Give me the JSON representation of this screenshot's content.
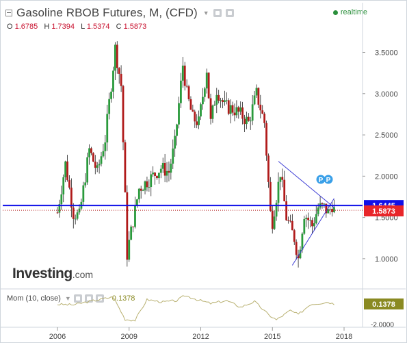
{
  "header": {
    "title": "Gasoline RBOB Futures, M, (CFD)",
    "realtime_label": "realtime"
  },
  "ohlc": {
    "o_label": "O",
    "o_value": "1.6785",
    "h_label": "H",
    "h_value": "1.7394",
    "l_label": "L",
    "l_value": "1.5374",
    "c_label": "C",
    "c_value": "1.5873"
  },
  "indicator": {
    "label": "Mom (10, close)",
    "value": "0.1378",
    "axis_label": "-2.0000"
  },
  "logo": {
    "brand": "Investing",
    "suffix": ".com"
  },
  "price_labels": {
    "resistance": "1.6445",
    "last": "1.5873"
  },
  "markers": [
    "P",
    "P"
  ],
  "colors": {
    "up": "#2a9a3c",
    "down": "#b01a1a",
    "hline": "#1010e8",
    "last_price": "#e8262a",
    "momentum": "#b8b070",
    "trendline": "#3f3fd6"
  },
  "chart_data": {
    "type": "candlestick",
    "title": "Gasoline RBOB Futures, M, (CFD)",
    "x_ticks": [
      "2006",
      "2009",
      "2012",
      "2015",
      "2018"
    ],
    "y_ticks": [
      "1.0000",
      "1.5000",
      "2.0000",
      "2.5000",
      "3.0000",
      "3.5000"
    ],
    "ylim": [
      0.75,
      3.72
    ],
    "interval": "monthly",
    "horizontal_lines": [
      {
        "value": 1.6445,
        "style": "solid"
      },
      {
        "value": 1.5873,
        "style": "dotted"
      }
    ],
    "trendlines": [
      {
        "from": [
          "2015-04",
          2.18
        ],
        "to": [
          "2017-08",
          1.62
        ]
      },
      {
        "from": [
          "2015-11",
          0.92
        ],
        "to": [
          "2017-08",
          1.73
        ]
      }
    ],
    "price_anchors": [
      [
        "2006-01",
        1.56
      ],
      [
        "2006-05",
        2.15
      ],
      [
        "2006-09",
        1.55
      ],
      [
        "2006-12",
        1.52
      ],
      [
        "2007-05",
        2.32
      ],
      [
        "2007-09",
        2.05
      ],
      [
        "2008-01",
        2.45
      ],
      [
        "2008-06",
        3.55
      ],
      [
        "2008-09",
        3.1
      ],
      [
        "2008-12",
        1.05
      ],
      [
        "2009-01",
        1.2
      ],
      [
        "2009-06",
        1.85
      ],
      [
        "2009-12",
        1.98
      ],
      [
        "2010-05",
        2.1
      ],
      [
        "2010-09",
        2.05
      ],
      [
        "2010-12",
        2.4
      ],
      [
        "2011-04",
        3.35
      ],
      [
        "2011-06",
        3.0
      ],
      [
        "2011-09",
        2.7
      ],
      [
        "2011-12",
        2.65
      ],
      [
        "2012-04",
        3.3
      ],
      [
        "2012-06",
        2.65
      ],
      [
        "2012-09",
        3.05
      ],
      [
        "2013-01",
        2.85
      ],
      [
        "2013-06",
        2.8
      ],
      [
        "2013-09",
        2.75
      ],
      [
        "2014-01",
        2.65
      ],
      [
        "2014-05",
        3.0
      ],
      [
        "2014-09",
        2.65
      ],
      [
        "2014-12",
        1.55
      ],
      [
        "2015-01",
        1.45
      ],
      [
        "2015-05",
        2.05
      ],
      [
        "2015-08",
        1.5
      ],
      [
        "2015-12",
        1.25
      ],
      [
        "2016-02",
        1.0
      ],
      [
        "2016-05",
        1.55
      ],
      [
        "2016-09",
        1.4
      ],
      [
        "2016-12",
        1.62
      ],
      [
        "2017-03",
        1.62
      ],
      [
        "2017-05",
        1.56
      ],
      [
        "2017-07",
        1.65
      ],
      [
        "2017-08",
        1.5873
      ]
    ],
    "momentum": {
      "name": "Mom (10, close)",
      "last_value": 0.1378,
      "ylim": [
        -2.2,
        1.6
      ],
      "anchors": [
        [
          "2006-01",
          0.1
        ],
        [
          "2006-09",
          0.05
        ],
        [
          "2007-06",
          0.45
        ],
        [
          "2008-05",
          0.9
        ],
        [
          "2008-11",
          -1.5
        ],
        [
          "2009-04",
          -1.6
        ],
        [
          "2009-10",
          0.6
        ],
        [
          "2010-06",
          0.35
        ],
        [
          "2011-01",
          0.5
        ],
        [
          "2011-05",
          1.05
        ],
        [
          "2011-12",
          0.55
        ],
        [
          "2012-06",
          0.2
        ],
        [
          "2013-02",
          0.5
        ],
        [
          "2013-09",
          -0.2
        ],
        [
          "2014-04",
          0.4
        ],
        [
          "2014-11",
          -1.0
        ],
        [
          "2015-03",
          -1.55
        ],
        [
          "2015-10",
          -0.55
        ],
        [
          "2016-02",
          -1.0
        ],
        [
          "2016-08",
          0.1
        ],
        [
          "2016-12",
          0.2
        ],
        [
          "2017-05",
          0.35
        ],
        [
          "2017-08",
          0.1378
        ]
      ]
    }
  }
}
